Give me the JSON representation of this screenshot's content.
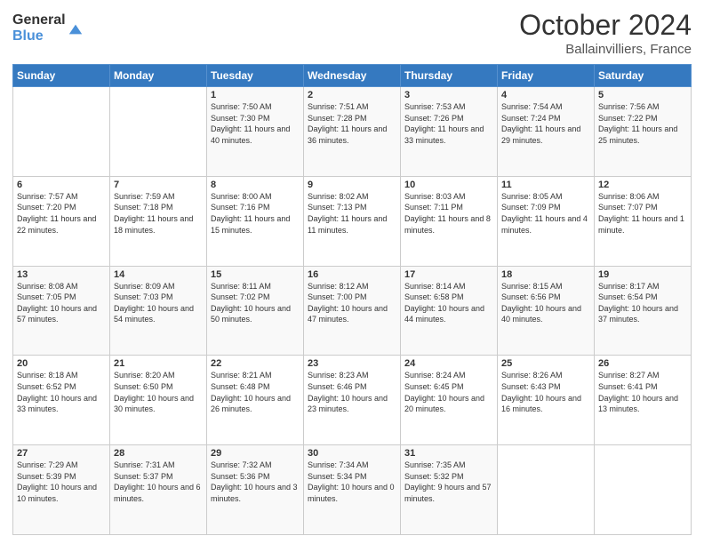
{
  "logo": {
    "general": "General",
    "blue": "Blue"
  },
  "header": {
    "month": "October 2024",
    "location": "Ballainvilliers, France"
  },
  "weekdays": [
    "Sunday",
    "Monday",
    "Tuesday",
    "Wednesday",
    "Thursday",
    "Friday",
    "Saturday"
  ],
  "weeks": [
    [
      {
        "date": "",
        "sunrise": "",
        "sunset": "",
        "daylight": ""
      },
      {
        "date": "",
        "sunrise": "",
        "sunset": "",
        "daylight": ""
      },
      {
        "date": "1",
        "sunrise": "Sunrise: 7:50 AM",
        "sunset": "Sunset: 7:30 PM",
        "daylight": "Daylight: 11 hours and 40 minutes."
      },
      {
        "date": "2",
        "sunrise": "Sunrise: 7:51 AM",
        "sunset": "Sunset: 7:28 PM",
        "daylight": "Daylight: 11 hours and 36 minutes."
      },
      {
        "date": "3",
        "sunrise": "Sunrise: 7:53 AM",
        "sunset": "Sunset: 7:26 PM",
        "daylight": "Daylight: 11 hours and 33 minutes."
      },
      {
        "date": "4",
        "sunrise": "Sunrise: 7:54 AM",
        "sunset": "Sunset: 7:24 PM",
        "daylight": "Daylight: 11 hours and 29 minutes."
      },
      {
        "date": "5",
        "sunrise": "Sunrise: 7:56 AM",
        "sunset": "Sunset: 7:22 PM",
        "daylight": "Daylight: 11 hours and 25 minutes."
      }
    ],
    [
      {
        "date": "6",
        "sunrise": "Sunrise: 7:57 AM",
        "sunset": "Sunset: 7:20 PM",
        "daylight": "Daylight: 11 hours and 22 minutes."
      },
      {
        "date": "7",
        "sunrise": "Sunrise: 7:59 AM",
        "sunset": "Sunset: 7:18 PM",
        "daylight": "Daylight: 11 hours and 18 minutes."
      },
      {
        "date": "8",
        "sunrise": "Sunrise: 8:00 AM",
        "sunset": "Sunset: 7:16 PM",
        "daylight": "Daylight: 11 hours and 15 minutes."
      },
      {
        "date": "9",
        "sunrise": "Sunrise: 8:02 AM",
        "sunset": "Sunset: 7:13 PM",
        "daylight": "Daylight: 11 hours and 11 minutes."
      },
      {
        "date": "10",
        "sunrise": "Sunrise: 8:03 AM",
        "sunset": "Sunset: 7:11 PM",
        "daylight": "Daylight: 11 hours and 8 minutes."
      },
      {
        "date": "11",
        "sunrise": "Sunrise: 8:05 AM",
        "sunset": "Sunset: 7:09 PM",
        "daylight": "Daylight: 11 hours and 4 minutes."
      },
      {
        "date": "12",
        "sunrise": "Sunrise: 8:06 AM",
        "sunset": "Sunset: 7:07 PM",
        "daylight": "Daylight: 11 hours and 1 minute."
      }
    ],
    [
      {
        "date": "13",
        "sunrise": "Sunrise: 8:08 AM",
        "sunset": "Sunset: 7:05 PM",
        "daylight": "Daylight: 10 hours and 57 minutes."
      },
      {
        "date": "14",
        "sunrise": "Sunrise: 8:09 AM",
        "sunset": "Sunset: 7:03 PM",
        "daylight": "Daylight: 10 hours and 54 minutes."
      },
      {
        "date": "15",
        "sunrise": "Sunrise: 8:11 AM",
        "sunset": "Sunset: 7:02 PM",
        "daylight": "Daylight: 10 hours and 50 minutes."
      },
      {
        "date": "16",
        "sunrise": "Sunrise: 8:12 AM",
        "sunset": "Sunset: 7:00 PM",
        "daylight": "Daylight: 10 hours and 47 minutes."
      },
      {
        "date": "17",
        "sunrise": "Sunrise: 8:14 AM",
        "sunset": "Sunset: 6:58 PM",
        "daylight": "Daylight: 10 hours and 44 minutes."
      },
      {
        "date": "18",
        "sunrise": "Sunrise: 8:15 AM",
        "sunset": "Sunset: 6:56 PM",
        "daylight": "Daylight: 10 hours and 40 minutes."
      },
      {
        "date": "19",
        "sunrise": "Sunrise: 8:17 AM",
        "sunset": "Sunset: 6:54 PM",
        "daylight": "Daylight: 10 hours and 37 minutes."
      }
    ],
    [
      {
        "date": "20",
        "sunrise": "Sunrise: 8:18 AM",
        "sunset": "Sunset: 6:52 PM",
        "daylight": "Daylight: 10 hours and 33 minutes."
      },
      {
        "date": "21",
        "sunrise": "Sunrise: 8:20 AM",
        "sunset": "Sunset: 6:50 PM",
        "daylight": "Daylight: 10 hours and 30 minutes."
      },
      {
        "date": "22",
        "sunrise": "Sunrise: 8:21 AM",
        "sunset": "Sunset: 6:48 PM",
        "daylight": "Daylight: 10 hours and 26 minutes."
      },
      {
        "date": "23",
        "sunrise": "Sunrise: 8:23 AM",
        "sunset": "Sunset: 6:46 PM",
        "daylight": "Daylight: 10 hours and 23 minutes."
      },
      {
        "date": "24",
        "sunrise": "Sunrise: 8:24 AM",
        "sunset": "Sunset: 6:45 PM",
        "daylight": "Daylight: 10 hours and 20 minutes."
      },
      {
        "date": "25",
        "sunrise": "Sunrise: 8:26 AM",
        "sunset": "Sunset: 6:43 PM",
        "daylight": "Daylight: 10 hours and 16 minutes."
      },
      {
        "date": "26",
        "sunrise": "Sunrise: 8:27 AM",
        "sunset": "Sunset: 6:41 PM",
        "daylight": "Daylight: 10 hours and 13 minutes."
      }
    ],
    [
      {
        "date": "27",
        "sunrise": "Sunrise: 7:29 AM",
        "sunset": "Sunset: 5:39 PM",
        "daylight": "Daylight: 10 hours and 10 minutes."
      },
      {
        "date": "28",
        "sunrise": "Sunrise: 7:31 AM",
        "sunset": "Sunset: 5:37 PM",
        "daylight": "Daylight: 10 hours and 6 minutes."
      },
      {
        "date": "29",
        "sunrise": "Sunrise: 7:32 AM",
        "sunset": "Sunset: 5:36 PM",
        "daylight": "Daylight: 10 hours and 3 minutes."
      },
      {
        "date": "30",
        "sunrise": "Sunrise: 7:34 AM",
        "sunset": "Sunset: 5:34 PM",
        "daylight": "Daylight: 10 hours and 0 minutes."
      },
      {
        "date": "31",
        "sunrise": "Sunrise: 7:35 AM",
        "sunset": "Sunset: 5:32 PM",
        "daylight": "Daylight: 9 hours and 57 minutes."
      },
      {
        "date": "",
        "sunrise": "",
        "sunset": "",
        "daylight": ""
      },
      {
        "date": "",
        "sunrise": "",
        "sunset": "",
        "daylight": ""
      }
    ]
  ]
}
